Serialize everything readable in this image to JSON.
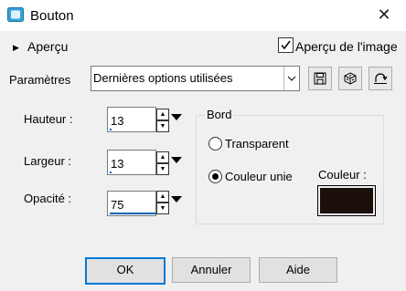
{
  "window": {
    "title": "Bouton",
    "close_label": "✕"
  },
  "header": {
    "apercu_label": "Aperçu",
    "preview_checkbox": {
      "label": "Aperçu de l'image",
      "checked": true
    }
  },
  "params": {
    "label": "Paramètres",
    "preset_value": "Dernières options utilisées"
  },
  "fields": {
    "hauteur": {
      "label": "Hauteur :",
      "value": "13"
    },
    "largeur": {
      "label": "Largeur :",
      "value": "13"
    },
    "opacite": {
      "label": "Opacité :",
      "value": "75"
    }
  },
  "bord": {
    "label": "Bord",
    "transparent_label": "Transparent",
    "couleur_unie_label": "Couleur unie",
    "selected": "couleur_unie",
    "couleur_label": "Couleur :",
    "couleur_value": "#1a0f0a"
  },
  "buttons": {
    "ok": "OK",
    "annuler": "Annuler",
    "aide": "Aide"
  }
}
